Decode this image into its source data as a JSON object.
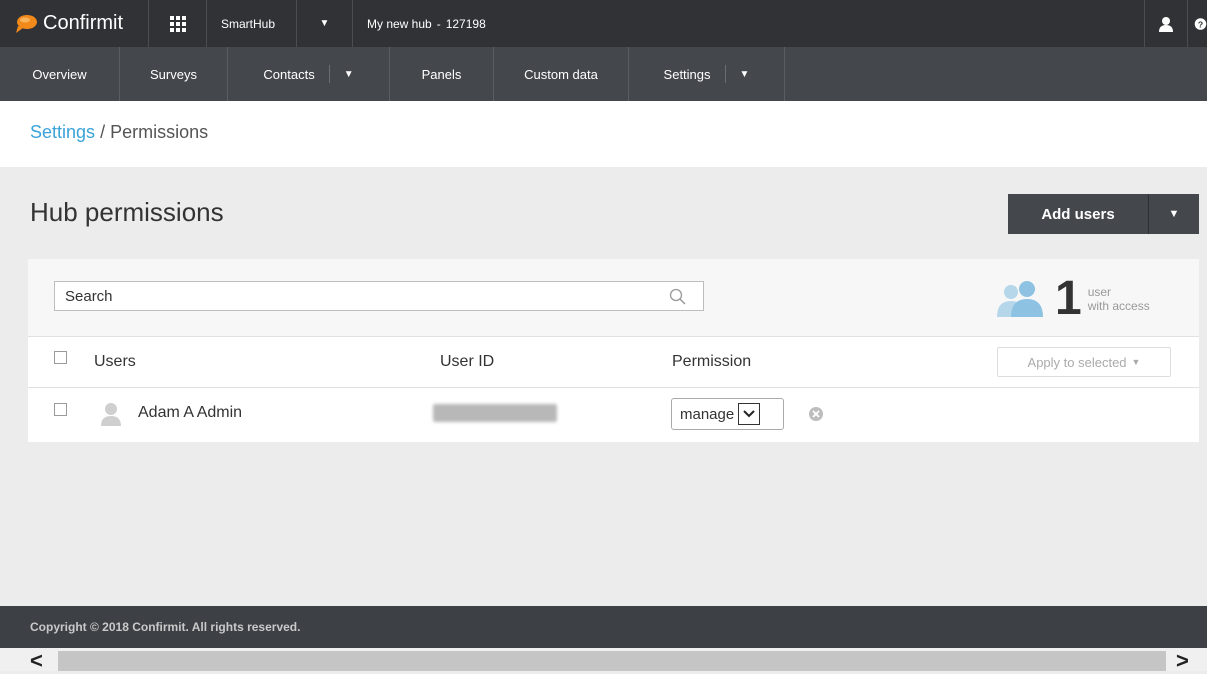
{
  "topbar": {
    "brand": "Confirmit",
    "hub_selector": "SmartHub",
    "hub_name": "My new hub",
    "hub_separator": "-",
    "hub_id": "127198"
  },
  "nav": {
    "items": [
      {
        "label": "Overview"
      },
      {
        "label": "Surveys"
      },
      {
        "label": "Contacts"
      },
      {
        "label": "Panels"
      },
      {
        "label": "Custom data"
      },
      {
        "label": "Settings"
      }
    ]
  },
  "breadcrumb": {
    "parent": "Settings",
    "separator": "/",
    "current": "Permissions"
  },
  "page": {
    "title": "Hub permissions",
    "add_users_label": "Add users"
  },
  "search": {
    "value": "Search"
  },
  "access_count": {
    "number": "1",
    "line1": "user",
    "line2": "with access"
  },
  "table": {
    "columns": {
      "users": "Users",
      "user_id": "User ID",
      "permission": "Permission"
    },
    "apply_label": "Apply to selected",
    "rows": [
      {
        "name": "Adam A Admin",
        "permission": "manage"
      }
    ]
  },
  "footer": {
    "copyright": "Copyright © 2018 Confirmit. All rights reserved."
  },
  "colors": {
    "topbar": "#303236",
    "navbar": "#44474c",
    "link": "#3aa3d8",
    "logo_orange": "#f28a1b"
  }
}
